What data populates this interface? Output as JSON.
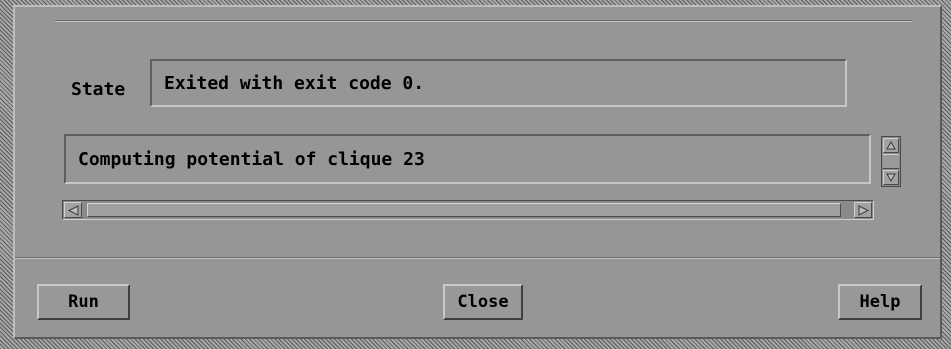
{
  "state": {
    "label": "State",
    "value": "Exited with exit code 0."
  },
  "log": {
    "text": "Computing potential of clique 23"
  },
  "buttons": {
    "run": "Run",
    "close": "Close",
    "help": "Help"
  },
  "icons": {
    "scroll_up": "arrow-up-icon",
    "scroll_down": "arrow-down-icon",
    "scroll_left": "arrow-left-icon",
    "scroll_right": "arrow-right-icon"
  }
}
